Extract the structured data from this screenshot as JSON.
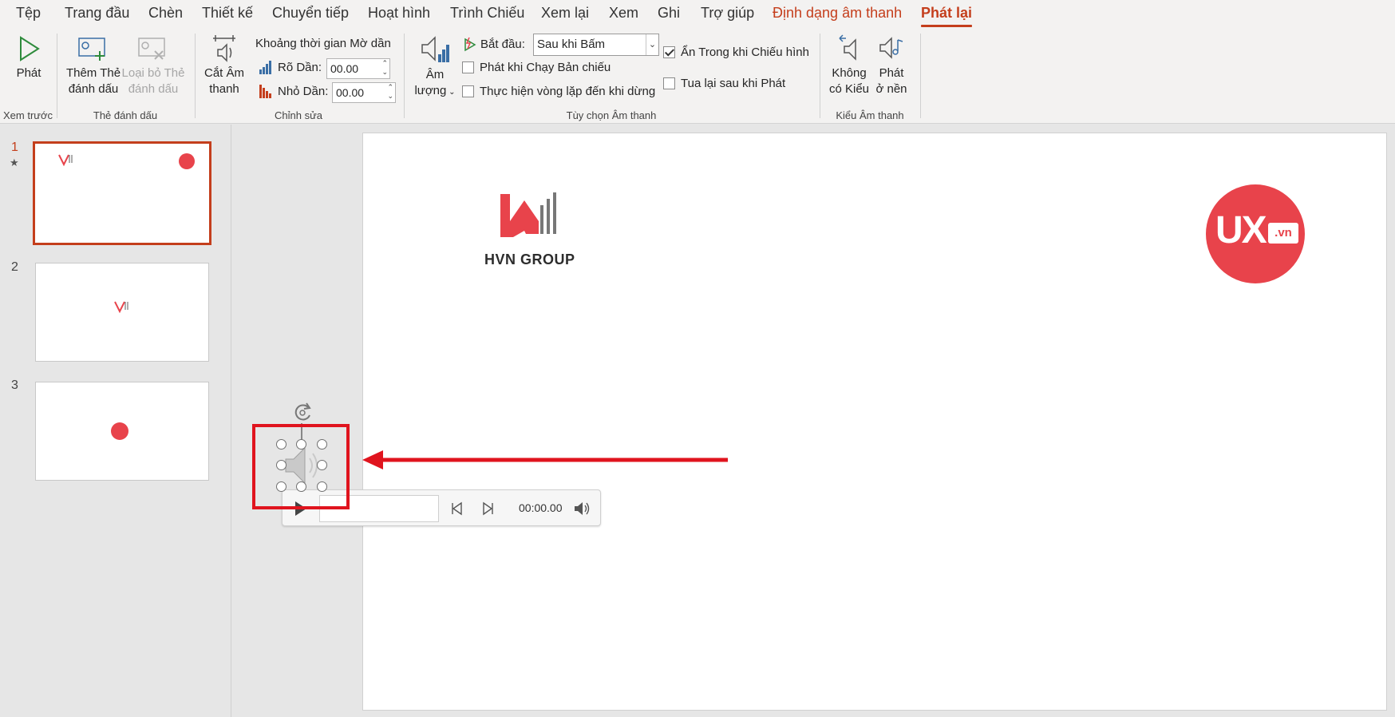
{
  "tabs": [
    {
      "label": "Tệp",
      "state": "normal"
    },
    {
      "label": "Trang đầu",
      "state": "normal"
    },
    {
      "label": "Chèn",
      "state": "normal"
    },
    {
      "label": "Thiết kế",
      "state": "normal"
    },
    {
      "label": "Chuyển tiếp",
      "state": "normal"
    },
    {
      "label": "Hoạt hình",
      "state": "normal"
    },
    {
      "label": "Trình Chiếu",
      "state": "normal"
    },
    {
      "label": "Xem lại",
      "state": "normal"
    },
    {
      "label": "Xem",
      "state": "normal"
    },
    {
      "label": "Ghi",
      "state": "normal"
    },
    {
      "label": "Trợ giúp",
      "state": "normal"
    },
    {
      "label": "Định dạng âm thanh",
      "state": "accent"
    },
    {
      "label": "Phát lại",
      "state": "active"
    }
  ],
  "ribbon": {
    "preview": {
      "play": "Phát",
      "group": "Xem trước"
    },
    "bookmarks": {
      "add_line1": "Thêm Thẻ",
      "add_line2": "đánh dấu",
      "remove_line1": "Loại bỏ Thẻ",
      "remove_line2": "đánh dấu",
      "group": "Thẻ đánh dấu"
    },
    "editing": {
      "trim_line1": "Cắt Âm",
      "trim_line2": "thanh",
      "fade_title": "Khoảng thời gian Mờ dần",
      "fade_in_label": "Rõ Dần:",
      "fade_in_value": "00.00",
      "fade_out_label": "Nhỏ Dần:",
      "fade_out_value": "00.00",
      "group": "Chỉnh sửa"
    },
    "audio_options": {
      "volume_line1": "Âm",
      "volume_line2": "lượng",
      "start_label": "Bắt đầu:",
      "start_value": "Sau khi Bấm",
      "play_across_slides": "Phát khi Chạy Bản chiếu",
      "loop_until_stopped": "Thực hiện vòng lặp đến khi dừng",
      "hide_during_show": "Ẩn Trong khi Chiếu hình",
      "rewind_after_playing": "Tua lại sau khi Phát",
      "hide_checked": true,
      "group": "Tùy chọn Âm thanh"
    },
    "audio_styles": {
      "no_style_line1": "Không",
      "no_style_line2": "có Kiểu",
      "bg_line1": "Phát",
      "bg_line2": "ở nền",
      "group": "Kiểu Âm thanh"
    }
  },
  "thumbnails": [
    {
      "number": "1",
      "selected": true
    },
    {
      "number": "2",
      "selected": false
    },
    {
      "number": "3",
      "selected": false
    }
  ],
  "slide": {
    "logo_left_text": "HVN GROUP",
    "logo_right_text": "UX",
    "logo_right_suffix": ".vn"
  },
  "audio_player": {
    "time": "00:00.00"
  },
  "colors": {
    "accent": "#c43e1c",
    "annotation_red": "#e0141e",
    "ux_red": "#e8434b",
    "hvn_red": "#e8434b"
  }
}
